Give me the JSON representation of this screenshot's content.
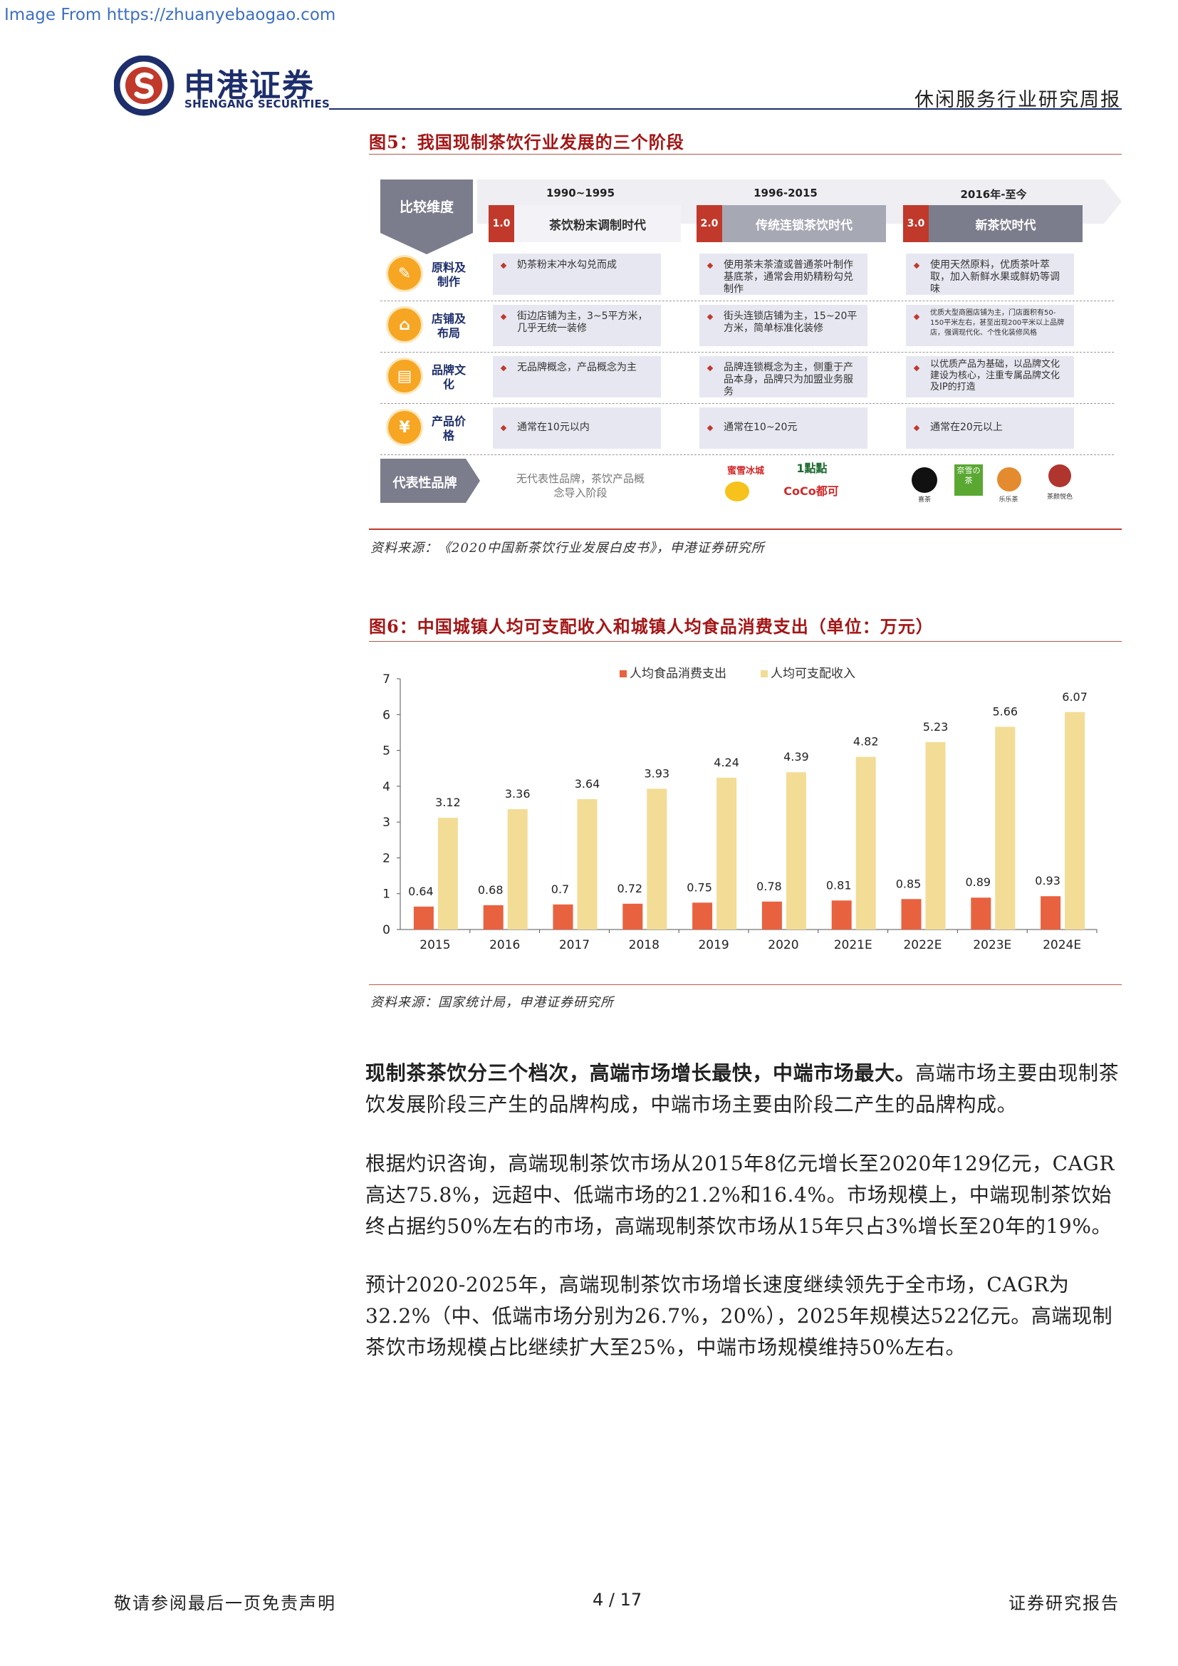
{
  "watermark": "Image From https://zhuanyebaogao.com",
  "header": {
    "brand_cn": "申港证券",
    "brand_en": "SHENGANG SECURITIES",
    "report_type": "休闲服务行业研究周报"
  },
  "figure5": {
    "title": "图5：我国现制茶饮行业发展的三个阶段",
    "corner_label": "比较维度",
    "eras": [
      {
        "years": "1990~1995",
        "num": "1.0",
        "name": "茶饮粉末调制时代"
      },
      {
        "years": "1996-2015",
        "num": "2.0",
        "name": "传统连锁茶饮时代"
      },
      {
        "years": "2016年-至今",
        "num": "3.0",
        "name": "新茶饮时代"
      }
    ],
    "rows": [
      {
        "label": "原料及制作",
        "cells": [
          "奶茶粉末冲水勾兑而成",
          "使用茶末茶渣或普通茶叶制作基底茶，通常会用奶精粉勾兑制作",
          "使用天然原料，优质茶叶萃取，加入新鲜水果或鲜奶等调味"
        ]
      },
      {
        "label": "店铺及布局",
        "cells": [
          "街边店铺为主，3~5平方米，几乎无统一装修",
          "街头连锁店铺为主，15~20平方米，简单标准化装修",
          "优质大型商圈店铺为主，门店面积有50-150平米左右，甚至出现200平米以上品牌店，强调现代化、个性化装修风格"
        ]
      },
      {
        "label": "品牌文化",
        "cells": [
          "无品牌概念，产品概念为主",
          "品牌连锁概念为主，侧重于产品本身，品牌只为加盟业务服务",
          "以优质产品为基础，以品牌文化建设为核心，注重专属品牌文化及IP的打造"
        ]
      },
      {
        "label": "产品价格",
        "cells": [
          "通常在10元以内",
          "通常在10~20元",
          "通常在20元以上"
        ]
      }
    ],
    "brand_row_label": "代表性品牌",
    "brand_row_text": "无代表性品牌，茶饮产品概念导入阶段",
    "brands_era2": [
      "蜜雪冰城",
      "1點點",
      "CoCo都可"
    ],
    "brands_era3": [
      "喜茶",
      "奈雪の茶",
      "乐乐茶",
      "茶颜悦色"
    ],
    "source": "资料来源：《2020中国新茶饮行业发展白皮书》，申港证券研究所"
  },
  "figure6": {
    "title": "图6：中国城镇人均可支配收入和城镇人均食品消费支出（单位：万元）",
    "source": "资料来源：国家统计局，申港证券研究所"
  },
  "chart_data": {
    "type": "bar",
    "categories": [
      "2015",
      "2016",
      "2017",
      "2018",
      "2019",
      "2020",
      "2021E",
      "2022E",
      "2023E",
      "2024E"
    ],
    "series": [
      {
        "name": "人均食品消费支出",
        "values": [
          0.64,
          0.68,
          0.7,
          0.72,
          0.75,
          0.78,
          0.81,
          0.85,
          0.89,
          0.93
        ],
        "color": "#e8623f"
      },
      {
        "name": "人均可支配收入",
        "values": [
          3.12,
          3.36,
          3.64,
          3.93,
          4.24,
          4.39,
          4.82,
          5.23,
          5.66,
          6.07
        ],
        "color": "#f3dc95"
      }
    ],
    "ylim": [
      0,
      7
    ],
    "yticks": [
      0,
      1,
      2,
      3,
      4,
      5,
      6,
      7
    ],
    "legend": "top-center"
  },
  "body": {
    "p1_bold": "现制茶茶饮分三个档次，高端市场增长最快，中端市场最大。",
    "p1_rest": "高端市场主要由现制茶饮发展阶段三产生的品牌构成，中端市场主要由阶段二产生的品牌构成。",
    "p2": "根据灼识咨询，高端现制茶饮市场从2015年8亿元增长至2020年129亿元，CAGR高达75.8%，远超中、低端市场的21.2%和16.4%。市场规模上，中端现制茶饮始终占据约50%左右的市场，高端现制茶饮市场从15年只占3%增长至20年的19%。",
    "p3": "预计2020-2025年，高端现制茶饮市场增长速度继续领先于全市场，CAGR为32.2%（中、低端市场分别为26.7%，20%），2025年规模达522亿元。高端现制茶饮市场规模占比继续扩大至25%，中端市场规模维持50%左右。"
  },
  "footer": {
    "left": "敬请参阅最后一页免责声明",
    "page": "4 / 17",
    "right": "证券研究报告"
  }
}
